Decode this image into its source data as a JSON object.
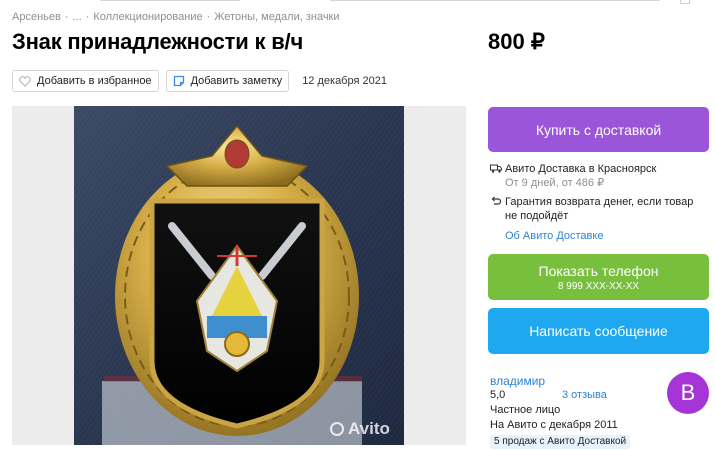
{
  "breadcrumbs": [
    "Арсеньев",
    "...",
    "Коллекционирование",
    "Жетоны, медали, значки"
  ],
  "breadcrumb_separator": "·",
  "title": "Знак принадлежности к в/ч",
  "price": "800 ₽",
  "actions": {
    "favorite_label": "Добавить в избранное",
    "note_label": "Добавить заметку",
    "date": "12 декабря 2021"
  },
  "gallery": {
    "watermark": "Avito"
  },
  "buy_button": "Купить с доставкой",
  "delivery": {
    "title": "Авито Доставка в Красноярск",
    "subtitle": "От 9 дней, от 486 ₽"
  },
  "guarantee": {
    "line1": "Гарантия возврата денег, если товар",
    "line2": "не подойдёт"
  },
  "delivery_link": "Об Авито Доставке",
  "phone_button": {
    "label": "Показать телефон",
    "number": "8 999 XXX-XX-XX"
  },
  "message_button": "Написать сообщение",
  "seller": {
    "name": "владимир",
    "rating": "5,0",
    "reviews": "3 отзыва",
    "type": "Частное лицо",
    "since": "На Авито с декабря 2011",
    "badge": "5 продаж с Авито Доставкой",
    "avatar_letter": "В"
  },
  "colors": {
    "buy": "#9b55d8",
    "phone": "#78bf3e",
    "message": "#1fa7f0",
    "link": "#2b85d5",
    "avatar": "#a535d6"
  }
}
